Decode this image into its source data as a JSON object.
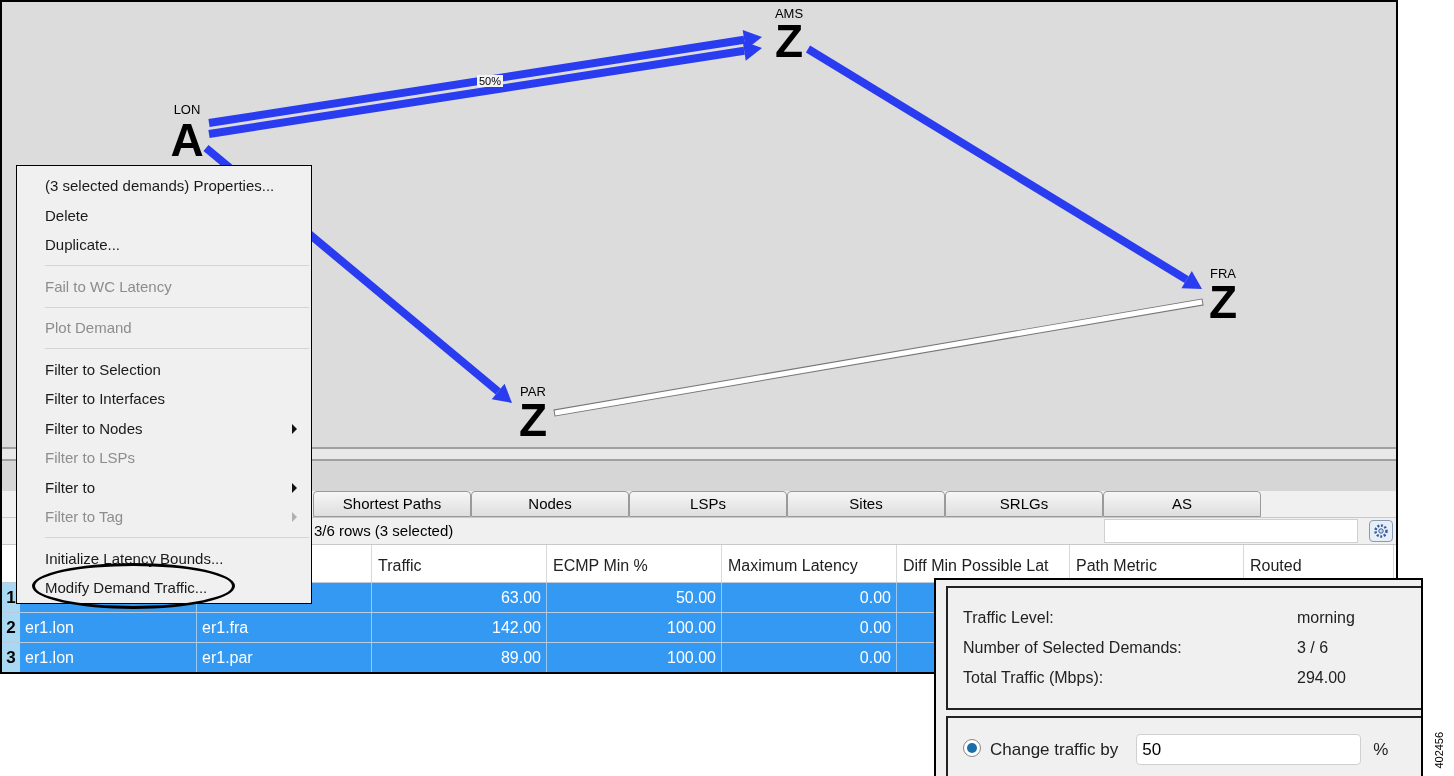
{
  "map": {
    "nodes": [
      {
        "label": "LON",
        "symbol": "A"
      },
      {
        "label": "AMS",
        "symbol": "Z"
      },
      {
        "label": "FRA",
        "symbol": "Z"
      },
      {
        "label": "PAR",
        "symbol": "Z"
      }
    ],
    "links": [
      {
        "kind": "busy"
      },
      {
        "kind": "busy"
      },
      {
        "kind": "busy"
      },
      {
        "kind": "busy"
      },
      {
        "kind": "idle"
      }
    ],
    "link_label": "50%"
  },
  "context_menu": [
    {
      "kind": "item",
      "label": "(3 selected demands) Properties...",
      "disabled": false,
      "submenu": false
    },
    {
      "kind": "item",
      "label": "Delete",
      "disabled": false,
      "submenu": false
    },
    {
      "kind": "item",
      "label": "Duplicate...",
      "disabled": false,
      "submenu": false
    },
    {
      "kind": "separator"
    },
    {
      "kind": "item",
      "label": "Fail to WC Latency",
      "disabled": true,
      "submenu": false
    },
    {
      "kind": "separator"
    },
    {
      "kind": "item",
      "label": "Plot Demand",
      "disabled": true,
      "submenu": false
    },
    {
      "kind": "separator"
    },
    {
      "kind": "item",
      "label": "Filter to Selection",
      "disabled": false,
      "submenu": false
    },
    {
      "kind": "item",
      "label": "Filter to Interfaces",
      "disabled": false,
      "submenu": false
    },
    {
      "kind": "item",
      "label": "Filter to Nodes",
      "disabled": false,
      "submenu": true
    },
    {
      "kind": "item",
      "label": "Filter to LSPs",
      "disabled": true,
      "submenu": false
    },
    {
      "kind": "item",
      "label": "Filter to",
      "disabled": false,
      "submenu": true
    },
    {
      "kind": "item",
      "label": "Filter to Tag",
      "disabled": true,
      "submenu": true
    },
    {
      "kind": "separator"
    },
    {
      "kind": "item",
      "label": "Initialize Latency Bounds...",
      "disabled": false,
      "submenu": false
    },
    {
      "kind": "item",
      "label": "Modify Demand Traffic...",
      "disabled": false,
      "submenu": false,
      "circled": true
    }
  ],
  "tabs": [
    {
      "label": "Shortest Paths",
      "selected": false
    },
    {
      "label": "Nodes",
      "selected": false
    },
    {
      "label": "LSPs",
      "selected": false
    },
    {
      "label": "Sites",
      "selected": false
    },
    {
      "label": "SRLGs",
      "selected": false
    },
    {
      "label": "AS",
      "selected": false
    }
  ],
  "row_count": "3/6 rows (3 selected)",
  "table": {
    "columns": [
      "Traffic",
      "ECMP Min %",
      "Maximum Latency",
      "Diff Min Possible Lat",
      "Path Metric",
      "Routed"
    ],
    "rows": [
      {
        "number": "1",
        "selected": true,
        "traffic": "63.00",
        "ecmp_min": "50.00",
        "max_latency": "0.00"
      },
      {
        "number": "2",
        "selected": true,
        "source": "er1.lon",
        "destination": "er1.fra",
        "traffic": "142.00",
        "ecmp_min": "100.00",
        "max_latency": "0.00"
      },
      {
        "number": "3",
        "selected": true,
        "source": "er1.lon",
        "destination": "er1.par",
        "traffic": "89.00",
        "ecmp_min": "100.00",
        "max_latency": "0.00"
      }
    ]
  },
  "dialog": {
    "summary": [
      {
        "label": "Traffic Level:",
        "value": "morning"
      },
      {
        "label": "Number of Selected Demands:",
        "value": "3 / 6"
      },
      {
        "label": "Total Traffic (Mbps):",
        "value": "294.00"
      }
    ],
    "change": {
      "label": "Change traffic by",
      "selected": true,
      "value": "50",
      "unit": "%"
    }
  },
  "figure_id": "402456"
}
